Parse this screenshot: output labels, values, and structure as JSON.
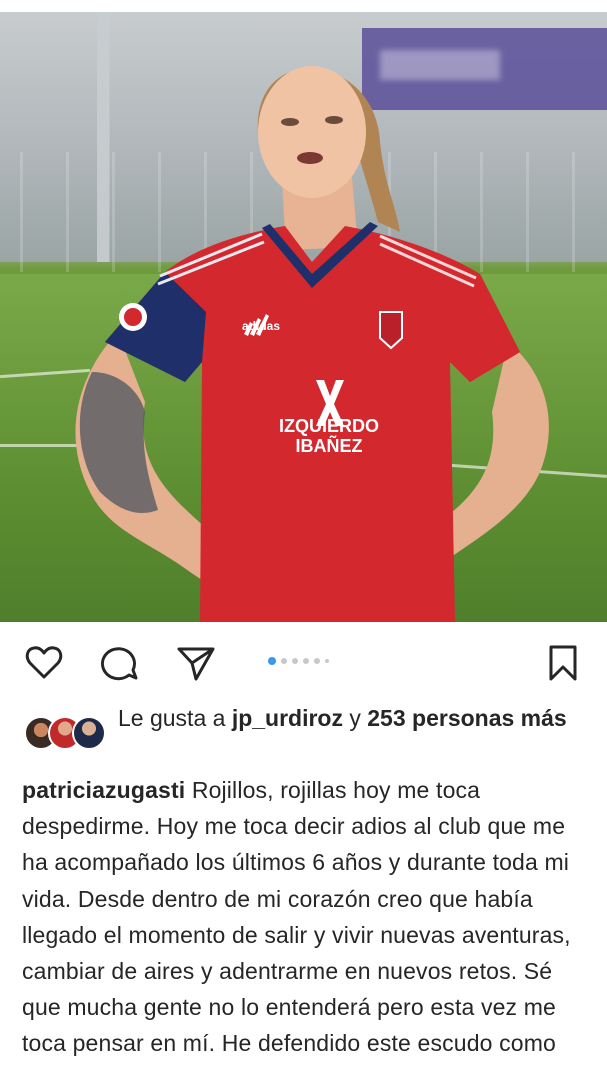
{
  "post": {
    "photo_alt": "Player in red jersey with hands on hips looking upward",
    "jersey": {
      "brand": "adidas",
      "sponsor_line1": "IZQUIERDO",
      "sponsor_line2": "IBAÑEZ"
    },
    "carousel": {
      "total_dots": 6,
      "active_index": 0
    }
  },
  "actions": {
    "like_icon": "heart-icon",
    "comment_icon": "comment-icon",
    "share_icon": "send-icon",
    "save_icon": "bookmark-icon"
  },
  "likes": {
    "prefix": "Le gusta a ",
    "user": "jp_urdiroz",
    "middle": " y ",
    "others": "253 personas más"
  },
  "caption": {
    "username": "patriciazugasti",
    "text": " Rojillos, rojillas hoy me toca despedirme. Hoy me toca decir adios al club que me ha acompañado los últimos 6 años y durante toda mi vida. Desde dentro de mi corazón creo que había llegado el momento de salir y vivir nuevas aventuras, cambiar de aires y adentrarme en nuevos retos. Sé que mucha gente no lo entenderá pero esta vez me toca pensar en mí. He defendido este escudo como"
  },
  "colors": {
    "jersey_red": "#d2282e",
    "jersey_navy": "#1f2f6a",
    "grass": "#5e8f32",
    "dot_active": "#3897f0",
    "text": "#262626"
  }
}
